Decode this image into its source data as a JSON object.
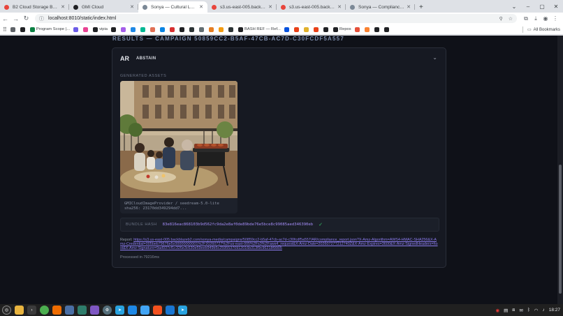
{
  "browser": {
    "tabs": [
      {
        "title": "B2 Cloud Storage Buckets",
        "color": "#e8453c",
        "active": false
      },
      {
        "title": "GMI Cloud",
        "color": "#202124",
        "active": false
      },
      {
        "title": "Sonya — Cultural Localizati",
        "color": "#7b8896",
        "active": true
      },
      {
        "title": "s3.us-east-005.backblazeb2",
        "color": "#e8453c",
        "active": false
      },
      {
        "title": "s3.us-east-005.backblazeb2",
        "color": "#e8453c",
        "active": false
      },
      {
        "title": "Sonya — Compliance Notari",
        "color": "#7b8896",
        "active": false
      }
    ],
    "url": "localhost:8010/static/index.html",
    "bookmarks": [
      {
        "label": "",
        "color": "#5f6368"
      },
      {
        "label": "",
        "color": "#202124"
      },
      {
        "label": "Program Scope |...",
        "color": "#0b8043"
      },
      {
        "label": "",
        "color": "#6c5ce7"
      },
      {
        "label": "",
        "color": "#e84393"
      },
      {
        "label": "vipia",
        "color": "#202124"
      },
      {
        "label": "",
        "color": "#202124"
      },
      {
        "label": "",
        "color": "#a55eea"
      },
      {
        "label": "",
        "color": "#1e88e5"
      },
      {
        "label": "",
        "color": "#00b894"
      },
      {
        "label": "",
        "color": "#e17055"
      },
      {
        "label": "",
        "color": "#0984e3"
      },
      {
        "label": "",
        "color": "#d63031"
      },
      {
        "label": "",
        "color": "#202124"
      },
      {
        "label": "",
        "color": "#2d3436"
      },
      {
        "label": "",
        "color": "#636e72"
      },
      {
        "label": "",
        "color": "#e67e22"
      },
      {
        "label": "",
        "color": "#f39c12"
      },
      {
        "label": "",
        "color": "#2d3436"
      },
      {
        "label": "BASH REF — Ref...",
        "color": "#202124"
      },
      {
        "label": "",
        "color": "#0652dd"
      },
      {
        "label": "",
        "color": "#e84118"
      },
      {
        "label": "",
        "color": "#e1b12c"
      },
      {
        "label": "",
        "color": "#e84118"
      },
      {
        "label": "",
        "color": "#202124"
      },
      {
        "label": "Repos",
        "color": "#202124"
      },
      {
        "label": "",
        "color": "#e55039"
      },
      {
        "label": "",
        "color": "#fa8231"
      },
      {
        "label": "",
        "color": "#202124"
      },
      {
        "label": "",
        "color": "#202124"
      }
    ],
    "all_bookmarks": "All Bookmarks"
  },
  "page": {
    "results_title": "RESULTS — CAMPAIGN 50859CC2-B5AF-47CB-AC7D-C30FCDF5A557",
    "language": "AR",
    "verdict": "ABSTAIN",
    "generated_label": "GENERATED ASSETS",
    "asset": {
      "provider": "GMICloudImageProvider / seedream-5.0-lite",
      "sha": "sha256: 23170dd349294dd7..."
    },
    "bundle_label": "BUNDLE HASH",
    "bundle_hash": "83e816eac868103b9d562fc9da2e8af0de89bde76e5bce8c99085aed346390eb",
    "report_prefix": "Report:",
    "report_url": "https://s3.us-east-005.backblazeb2.com/sonya-media/campaigns/50859cc2-b5af-47cb-ac7d-c30fcdf5a557/AR/compliance_report.json?X-Amz-Algorithm=AWS4-HMAC-SHA256&X-Amz-Credential=005beb79676e5c00000000001%2F20260727%2Fus-east-005%2Fs3%2Faws4_request&X-Amz-Date=20260727T212740Z&X-Amz-Expires=3600&X-Amz-SignedHeaders=host&X-Amz-Signature=9ad937cf1c326e3c630e59eeb949b5c25955370912016b313f9c96218f9905",
    "processed": "Processed in 79216ms"
  },
  "taskbar": {
    "time": "18:27"
  }
}
